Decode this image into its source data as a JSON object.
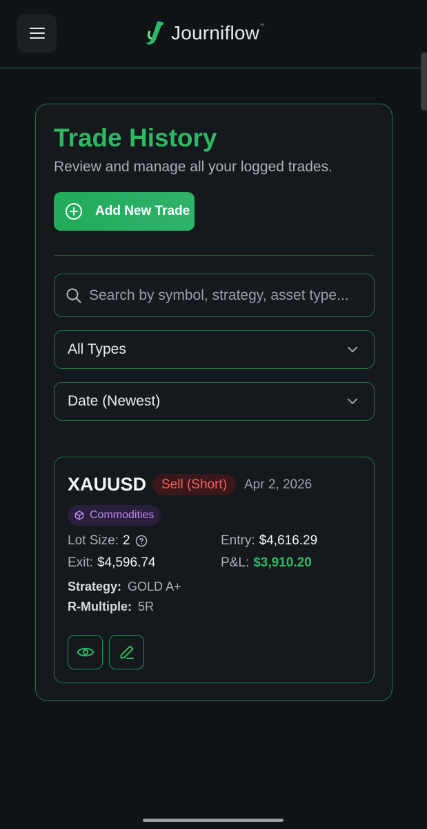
{
  "header": {
    "brand": "Journiflow",
    "trademark": "™",
    "menu_icon": "hamburger-icon",
    "logo_icon": "journiflow-logo-icon"
  },
  "page": {
    "title": "Trade History",
    "subtitle": "Review and manage all your logged trades.",
    "add_button_label": "Add New Trade"
  },
  "filters": {
    "search_placeholder": "Search by symbol, strategy, asset type...",
    "search_value": "",
    "type_selected": "All Types",
    "sort_selected": "Date (Newest)"
  },
  "trades": [
    {
      "symbol": "XAUUSD",
      "side": "Sell (Short)",
      "date": "Apr 2, 2026",
      "asset_type": "Commodities",
      "lot_size_label": "Lot Size:",
      "lot_size": "2",
      "entry_label": "Entry:",
      "entry": "$4,616.29",
      "exit_label": "Exit:",
      "exit": "$4,596.74",
      "pnl_label": "P&L:",
      "pnl": "$3,910.20",
      "strategy_label": "Strategy:",
      "strategy": "GOLD A+",
      "r_multiple_label": "R-Multiple:",
      "r_multiple": "5R"
    }
  ],
  "colors": {
    "accent": "#2fb863",
    "border": "#1f7a44",
    "background": "#111417",
    "sell": "#f06464",
    "asset_badge": "#b98cf0"
  }
}
